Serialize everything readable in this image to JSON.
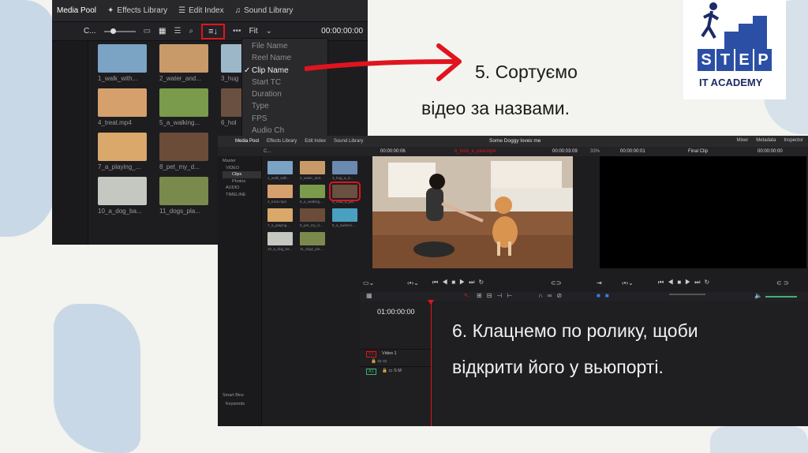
{
  "shot1": {
    "tabs": [
      "Media Pool",
      "Effects Library",
      "Edit Index",
      "Sound Library"
    ],
    "toolbar": {
      "bin_label": "C...",
      "zoom": "Fit",
      "timecode": "00:00:00:00"
    },
    "clips": [
      {
        "label": "1_walk_with..."
      },
      {
        "label": "2_water_and..."
      },
      {
        "label": "3_hug"
      },
      {
        "label": "4_treat.mp4"
      },
      {
        "label": "5_a_walking..."
      },
      {
        "label": "6_hol"
      },
      {
        "label": "7_a_playing_..."
      },
      {
        "label": "8_pet_my_d..."
      },
      {
        "label": "10_a_dog_ba..."
      },
      {
        "label": "11_dogs_pla..."
      }
    ],
    "sort_menu": [
      "File Name",
      "Reel Name",
      "Clip Name",
      "Start TC",
      "Duration",
      "Type",
      "FPS",
      "Audio Ch"
    ],
    "sort_selected": "Clip Name"
  },
  "note5": {
    "line1": "5. Сортуємо",
    "line2": "відео за назвами."
  },
  "logo": {
    "letters": [
      "S",
      "T",
      "E",
      "P"
    ],
    "subtitle": "IT ACADEMY"
  },
  "shot2": {
    "tabs": [
      "Media Pool",
      "Effects Library",
      "Edit Index",
      "Sound Library"
    ],
    "project": "Some Doggy loves me",
    "right_tabs": [
      "Mixer",
      "Metadata",
      "Inspector"
    ],
    "sub": {
      "bin": "C...",
      "tc1": "00:00:00:06",
      "clip": "6_hold_a_paw.mp4",
      "tc2": "00:00:03:09",
      "zoom": "33%",
      "tc3": "00:00:00:01",
      "final": "Final Clip",
      "tc4": "00:00:00:00"
    },
    "sidebar": [
      "Master",
      "VIDEO",
      "Clips",
      "Photos",
      "AUDIO",
      "TIMELINE"
    ],
    "smart_bins": [
      "Smart Bins",
      "Keywords"
    ],
    "clips": [
      {
        "label": "1_walk_with..."
      },
      {
        "label": "2_water_and..."
      },
      {
        "label": "3_hug_a_d..."
      },
      {
        "label": "4_treat.mp4"
      },
      {
        "label": "5_a_walking..."
      },
      {
        "label": "6_hold_a_pa..."
      },
      {
        "label": "7_a_playing..."
      },
      {
        "label": "8_pet_my_d..."
      },
      {
        "label": "9_a_swimmi..."
      },
      {
        "label": "10_a_dog_ba..."
      },
      {
        "label": "11_dogs_pla..."
      }
    ],
    "timeline_tc": "01:00:00:00",
    "tracks": [
      {
        "id": "V1",
        "name": "Video 1",
        "color": "#e0141e"
      },
      {
        "id": "A1",
        "name": "",
        "color": "#3cb371"
      }
    ]
  },
  "note6": {
    "line1": "6. Клацнемо по ролику, щоби",
    "line2": "відкрити його у вьюпорті."
  },
  "colors": {
    "accent": "#e0141e",
    "logo_blue": "#2a4fa5"
  }
}
